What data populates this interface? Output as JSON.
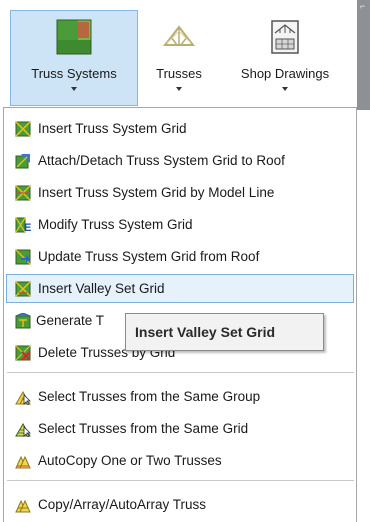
{
  "ribbon": {
    "buttons": [
      {
        "label": "Truss Systems",
        "icon": "truss-systems-icon",
        "active": true
      },
      {
        "label": "Trusses",
        "icon": "trusses-icon",
        "active": false
      },
      {
        "label": "Shop Drawings",
        "icon": "shop-drawings-icon",
        "active": false
      }
    ]
  },
  "menu": {
    "items": [
      {
        "label": "Insert Truss System Grid",
        "icon": "grid-green-icon"
      },
      {
        "label": "Attach/Detach Truss System Grid to Roof",
        "icon": "attach-grid-roof-icon"
      },
      {
        "label": "Insert Truss System Grid by Model Line",
        "icon": "grid-model-line-icon"
      },
      {
        "label": "Modify Truss System Grid",
        "icon": "modify-grid-icon"
      },
      {
        "label": "Update Truss System Grid from Roof",
        "icon": "update-grid-roof-icon"
      },
      {
        "label": "Insert Valley Set Grid",
        "icon": "valley-set-grid-icon",
        "highlighted": true
      },
      {
        "label": "Generate T",
        "icon": "generate-trusses-icon"
      },
      {
        "label": "Delete Trusses by Grid",
        "icon": "delete-trusses-icon"
      },
      {
        "label": "Select Trusses from the Same Group",
        "icon": "select-group-icon"
      },
      {
        "label": "Select Trusses from the Same Grid",
        "icon": "select-grid-icon"
      },
      {
        "label": "AutoCopy One or Two Trusses",
        "icon": "autocopy-icon"
      },
      {
        "label": "Copy/Array/AutoArray Truss",
        "icon": "copy-array-icon"
      }
    ]
  },
  "tooltip": {
    "text": "Insert Valley Set Grid"
  },
  "colors": {
    "ribbon_active": "#cde3f6",
    "menu_highlight": "#e5f1fb",
    "highlight_border": "#7fb0dd",
    "icon_green": "#4a9c3a",
    "icon_yellow": "#e8c21a"
  }
}
